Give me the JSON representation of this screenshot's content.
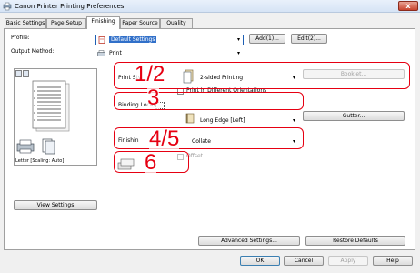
{
  "window": {
    "title": "Canon Printer Printing Preferences",
    "close_glyph": "x"
  },
  "tabs": [
    {
      "label": "Basic Settings"
    },
    {
      "label": "Page Setup"
    },
    {
      "label": "Finishing"
    },
    {
      "label": "Paper Source"
    },
    {
      "label": "Quality"
    }
  ],
  "profile": {
    "label": "Profile:",
    "value": "Default Settings",
    "add_label": "Add(1)...",
    "edit_label": "Edit(2)..."
  },
  "output_method": {
    "label": "Output Method:",
    "value": "Print"
  },
  "preview": {
    "caption": "Letter [Scaling: Auto]",
    "view_settings_label": "View Settings"
  },
  "finishing": {
    "print_style_label": "Print Sty",
    "print_style_value": "2-sided Printing",
    "booklet_label": "Booklet...",
    "print_diff_orient_label": "Print in Different Orientations",
    "binding_location_label": "Binding Locat",
    "binding_location_value": "Long Edge [Left]",
    "gutter_label": "Gutter...",
    "finishing_label": "Finishin",
    "finishing_value": "Collate",
    "offset_label": "Offset"
  },
  "annotations": {
    "a1": "1/2",
    "a2": "3",
    "a3": "4/5",
    "a4": "6",
    "color": "#e60012"
  },
  "buttons": {
    "advanced_settings": "Advanced Settings...",
    "restore_defaults": "Restore Defaults",
    "ok": "OK",
    "cancel": "Cancel",
    "apply": "Apply",
    "help": "Help"
  }
}
